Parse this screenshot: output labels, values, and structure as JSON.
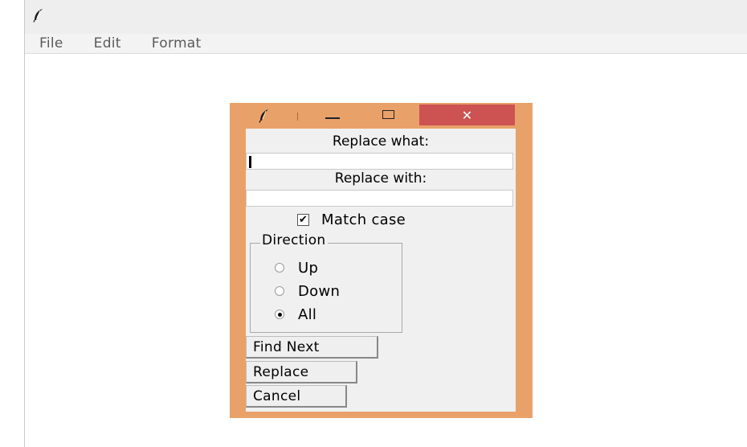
{
  "app": {
    "menu": [
      "File",
      "Edit",
      "Format"
    ],
    "icon": "feather-icon"
  },
  "dialog": {
    "icon": "feather-icon",
    "close_glyph": "✕",
    "replace_what_label": "Replace what:",
    "replace_what_value": "",
    "replace_with_label": "Replace with:",
    "replace_with_value": "",
    "match_case_label": "Match case",
    "match_case_checked": true,
    "direction": {
      "title": "Direction",
      "options": [
        "Up",
        "Down",
        "All"
      ],
      "selected": "All"
    },
    "buttons": {
      "find_next": "Find Next",
      "replace": "Replace",
      "cancel": "Cancel"
    }
  },
  "colors": {
    "dialog_frame": "#e9a16a",
    "close_button": "#cd5252"
  }
}
